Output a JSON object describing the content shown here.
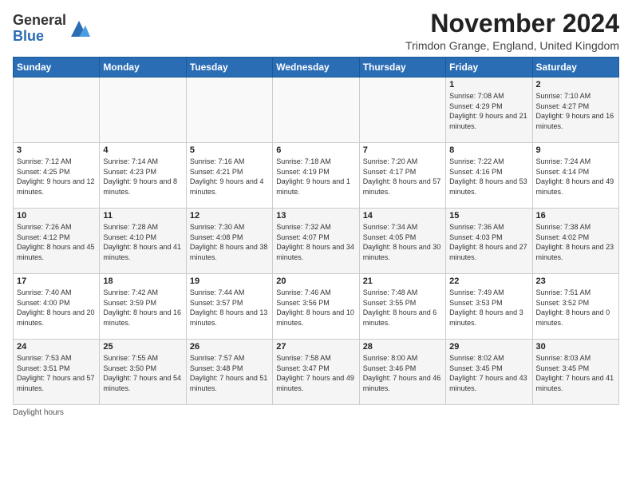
{
  "header": {
    "logo_general": "General",
    "logo_blue": "Blue",
    "month_title": "November 2024",
    "location": "Trimdon Grange, England, United Kingdom"
  },
  "days_of_week": [
    "Sunday",
    "Monday",
    "Tuesday",
    "Wednesday",
    "Thursday",
    "Friday",
    "Saturday"
  ],
  "weeks": [
    [
      {
        "day": "",
        "info": ""
      },
      {
        "day": "",
        "info": ""
      },
      {
        "day": "",
        "info": ""
      },
      {
        "day": "",
        "info": ""
      },
      {
        "day": "",
        "info": ""
      },
      {
        "day": "1",
        "info": "Sunrise: 7:08 AM\nSunset: 4:29 PM\nDaylight: 9 hours\nand 21 minutes."
      },
      {
        "day": "2",
        "info": "Sunrise: 7:10 AM\nSunset: 4:27 PM\nDaylight: 9 hours\nand 16 minutes."
      }
    ],
    [
      {
        "day": "3",
        "info": "Sunrise: 7:12 AM\nSunset: 4:25 PM\nDaylight: 9 hours\nand 12 minutes."
      },
      {
        "day": "4",
        "info": "Sunrise: 7:14 AM\nSunset: 4:23 PM\nDaylight: 9 hours\nand 8 minutes."
      },
      {
        "day": "5",
        "info": "Sunrise: 7:16 AM\nSunset: 4:21 PM\nDaylight: 9 hours\nand 4 minutes."
      },
      {
        "day": "6",
        "info": "Sunrise: 7:18 AM\nSunset: 4:19 PM\nDaylight: 9 hours\nand 1 minute."
      },
      {
        "day": "7",
        "info": "Sunrise: 7:20 AM\nSunset: 4:17 PM\nDaylight: 8 hours\nand 57 minutes."
      },
      {
        "day": "8",
        "info": "Sunrise: 7:22 AM\nSunset: 4:16 PM\nDaylight: 8 hours\nand 53 minutes."
      },
      {
        "day": "9",
        "info": "Sunrise: 7:24 AM\nSunset: 4:14 PM\nDaylight: 8 hours\nand 49 minutes."
      }
    ],
    [
      {
        "day": "10",
        "info": "Sunrise: 7:26 AM\nSunset: 4:12 PM\nDaylight: 8 hours\nand 45 minutes."
      },
      {
        "day": "11",
        "info": "Sunrise: 7:28 AM\nSunset: 4:10 PM\nDaylight: 8 hours\nand 41 minutes."
      },
      {
        "day": "12",
        "info": "Sunrise: 7:30 AM\nSunset: 4:08 PM\nDaylight: 8 hours\nand 38 minutes."
      },
      {
        "day": "13",
        "info": "Sunrise: 7:32 AM\nSunset: 4:07 PM\nDaylight: 8 hours\nand 34 minutes."
      },
      {
        "day": "14",
        "info": "Sunrise: 7:34 AM\nSunset: 4:05 PM\nDaylight: 8 hours\nand 30 minutes."
      },
      {
        "day": "15",
        "info": "Sunrise: 7:36 AM\nSunset: 4:03 PM\nDaylight: 8 hours\nand 27 minutes."
      },
      {
        "day": "16",
        "info": "Sunrise: 7:38 AM\nSunset: 4:02 PM\nDaylight: 8 hours\nand 23 minutes."
      }
    ],
    [
      {
        "day": "17",
        "info": "Sunrise: 7:40 AM\nSunset: 4:00 PM\nDaylight: 8 hours\nand 20 minutes."
      },
      {
        "day": "18",
        "info": "Sunrise: 7:42 AM\nSunset: 3:59 PM\nDaylight: 8 hours\nand 16 minutes."
      },
      {
        "day": "19",
        "info": "Sunrise: 7:44 AM\nSunset: 3:57 PM\nDaylight: 8 hours\nand 13 minutes."
      },
      {
        "day": "20",
        "info": "Sunrise: 7:46 AM\nSunset: 3:56 PM\nDaylight: 8 hours\nand 10 minutes."
      },
      {
        "day": "21",
        "info": "Sunrise: 7:48 AM\nSunset: 3:55 PM\nDaylight: 8 hours\nand 6 minutes."
      },
      {
        "day": "22",
        "info": "Sunrise: 7:49 AM\nSunset: 3:53 PM\nDaylight: 8 hours\nand 3 minutes."
      },
      {
        "day": "23",
        "info": "Sunrise: 7:51 AM\nSunset: 3:52 PM\nDaylight: 8 hours\nand 0 minutes."
      }
    ],
    [
      {
        "day": "24",
        "info": "Sunrise: 7:53 AM\nSunset: 3:51 PM\nDaylight: 7 hours\nand 57 minutes."
      },
      {
        "day": "25",
        "info": "Sunrise: 7:55 AM\nSunset: 3:50 PM\nDaylight: 7 hours\nand 54 minutes."
      },
      {
        "day": "26",
        "info": "Sunrise: 7:57 AM\nSunset: 3:48 PM\nDaylight: 7 hours\nand 51 minutes."
      },
      {
        "day": "27",
        "info": "Sunrise: 7:58 AM\nSunset: 3:47 PM\nDaylight: 7 hours\nand 49 minutes."
      },
      {
        "day": "28",
        "info": "Sunrise: 8:00 AM\nSunset: 3:46 PM\nDaylight: 7 hours\nand 46 minutes."
      },
      {
        "day": "29",
        "info": "Sunrise: 8:02 AM\nSunset: 3:45 PM\nDaylight: 7 hours\nand 43 minutes."
      },
      {
        "day": "30",
        "info": "Sunrise: 8:03 AM\nSunset: 3:45 PM\nDaylight: 7 hours\nand 41 minutes."
      }
    ]
  ],
  "footer": {
    "daylight_label": "Daylight hours"
  }
}
